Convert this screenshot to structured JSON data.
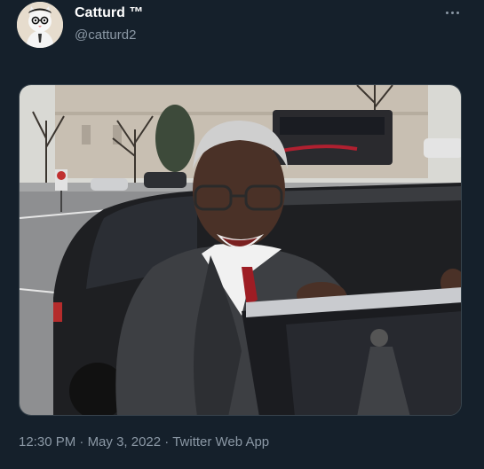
{
  "author": {
    "display_name": "Catturd ™",
    "handle": "@catturd2",
    "avatar_icon": "cat-avatar-icon"
  },
  "more_icon": "more-options-icon",
  "media": {
    "kind": "photo"
  },
  "meta": {
    "time": "12:30 PM",
    "separator": " · ",
    "date": "May 3, 2022",
    "source": "Twitter Web App"
  },
  "colors": {
    "background": "#15202b",
    "primary_text": "#ffffff",
    "secondary_text": "#8b98a5",
    "border": "#38444d"
  }
}
